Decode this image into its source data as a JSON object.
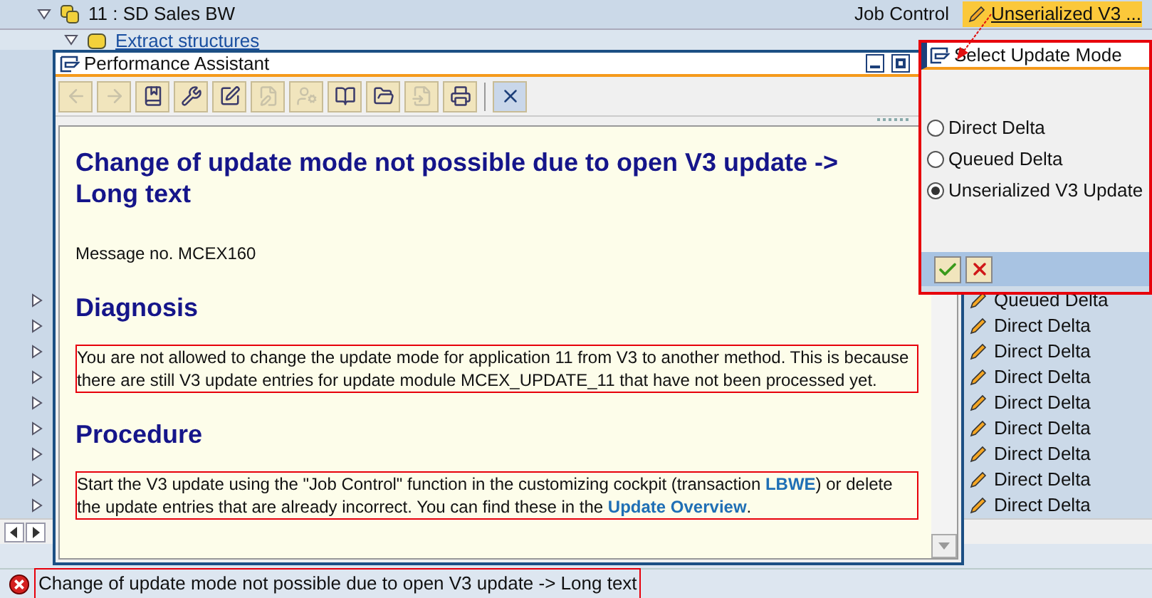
{
  "tree": {
    "label": "11 : SD Sales BW",
    "expanded": true,
    "children": [
      {
        "label": "Extract structures",
        "expanded": true
      }
    ]
  },
  "columns": [
    "Job Control"
  ],
  "update_mode_cell": {
    "text": "Unserialized V3 ...",
    "selected": true
  },
  "rows": [
    {
      "expanded": false,
      "update_mode": "Queued Delta"
    },
    {
      "expanded": false,
      "update_mode": "Direct Delta"
    },
    {
      "expanded": false,
      "update_mode": "Direct Delta"
    },
    {
      "expanded": false,
      "update_mode": "Direct Delta"
    },
    {
      "expanded": false,
      "update_mode": "Direct Delta"
    },
    {
      "expanded": false,
      "update_mode": "Direct Delta"
    },
    {
      "expanded": false,
      "update_mode": "Direct Delta"
    },
    {
      "expanded": false,
      "update_mode": "Direct Delta"
    },
    {
      "expanded": false,
      "update_mode": "Direct Delta"
    }
  ],
  "assistant": {
    "title": "Performance Assistant",
    "toolbar": [
      {
        "kind": "back",
        "disabled": true
      },
      {
        "kind": "forward",
        "disabled": true
      },
      {
        "kind": "book",
        "disabled": false
      },
      {
        "kind": "tools",
        "disabled": false
      },
      {
        "kind": "edit",
        "disabled": false
      },
      {
        "kind": "note",
        "disabled": true
      },
      {
        "kind": "user",
        "disabled": true
      },
      {
        "kind": "open-book",
        "disabled": false
      },
      {
        "kind": "folder",
        "disabled": false
      },
      {
        "kind": "export",
        "disabled": true
      },
      {
        "kind": "print",
        "disabled": false
      },
      {
        "kind": "close",
        "disabled": false
      }
    ],
    "heading": "Change of update mode not possible due to open V3 update -> Long text",
    "message_no": "Message no. MCEX160",
    "sections": [
      {
        "title": "Diagnosis",
        "parts": [
          {
            "kind": "text",
            "text": "You are not allowed to change the update mode for application 11 from V3 to another method. This is because there are still V3 update entries for update module MCEX_UPDATE_11 that have not been processed yet."
          }
        ]
      },
      {
        "title": "Procedure",
        "parts": [
          {
            "kind": "text",
            "text": "Start the V3  update using the \"Job Control\" function in the customizing cockpit (transaction "
          },
          {
            "kind": "link",
            "text": "LBWE"
          },
          {
            "kind": "text",
            "text": ") or delete the update entries that are already incorrect. You can find these in the "
          },
          {
            "kind": "link",
            "text": "Update Overview"
          },
          {
            "kind": "text",
            "text": "."
          }
        ]
      }
    ]
  },
  "dialog": {
    "title": "Select Update Mode",
    "options": [
      {
        "label": "Direct Delta",
        "selected": false
      },
      {
        "label": "Queued Delta",
        "selected": false
      },
      {
        "label": "Unserialized V3 Update",
        "selected": true
      }
    ],
    "buttons": [
      {
        "kind": "confirm"
      },
      {
        "kind": "cancel"
      }
    ]
  },
  "status_bar": {
    "text": "Change of update mode not possible due to open V3 update -> Long text"
  }
}
